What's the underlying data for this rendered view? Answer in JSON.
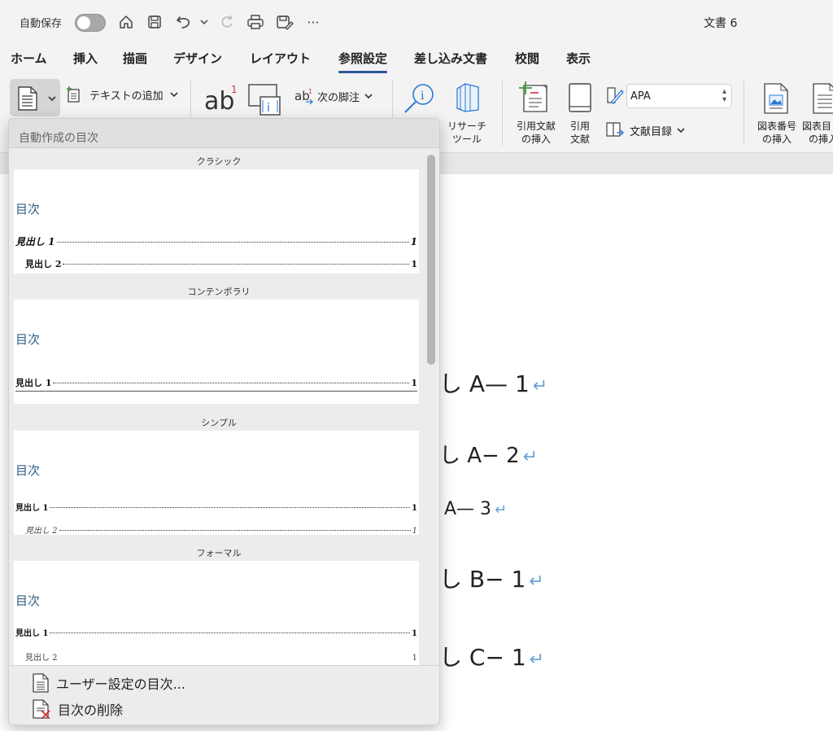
{
  "titlebar": {
    "autosave_label": "自動保存",
    "doc_title": "文書 6",
    "icons": [
      "toggle-off",
      "home-icon",
      "save-icon",
      "undo-icon",
      "chevron-down-icon",
      "redo-icon",
      "print-icon",
      "save-as-icon",
      "more-icon"
    ],
    "more_glyph": "···"
  },
  "tabs": [
    "ホーム",
    "挿入",
    "描画",
    "デザイン",
    "レイアウト",
    "参照設定",
    "差し込み文書",
    "校閲",
    "表示"
  ],
  "active_tab": "参照設定",
  "ribbon": {
    "add_text_label": "テキストの追加",
    "next_footnote_label": "次の脚注",
    "research_tool_label": [
      "リサーチ",
      "ツール"
    ],
    "insert_citation_label": [
      "引用文献",
      "の挿入"
    ],
    "citations_label": [
      "引用",
      "文献"
    ],
    "style_value": "APA",
    "bibliography_label": "文献目録",
    "insert_caption_label": [
      "図表番号",
      "の挿入"
    ],
    "table_of_figures_label": [
      "図表目",
      "の挿入"
    ]
  },
  "toc_dropdown": {
    "header": "自動作成の目次",
    "sections": [
      {
        "name": "クラシック",
        "toc_title": "目次",
        "rows": [
          {
            "text": "見出し 1",
            "page": "1"
          },
          {
            "text": "見出し 2",
            "page": "1"
          }
        ]
      },
      {
        "name": "コンテンポラリ",
        "toc_title": "目次",
        "rows": [
          {
            "text": "見出し 1",
            "page": "1"
          }
        ]
      },
      {
        "name": "シンプル",
        "toc_title": "目次",
        "rows": [
          {
            "text": "見出し 1",
            "page": "1"
          },
          {
            "text": "見出し 2",
            "page": "1"
          }
        ]
      },
      {
        "name": "フォーマル",
        "toc_title": "目次",
        "rows": [
          {
            "text": "見出し 1",
            "page": "1"
          },
          {
            "text": "見出し 2",
            "page": "1"
          }
        ]
      }
    ],
    "custom_toc": "ユーザー設定の目次...",
    "remove_toc": "目次の削除"
  },
  "document": {
    "headings": [
      "し A— 1",
      "し A− 2",
      "A— 3",
      "し B− 1",
      "し C− 1"
    ],
    "paragraph_mark": "↵"
  },
  "colors": {
    "accent": "#2b579a",
    "toc_title": "#2e5f87",
    "paragraph_mark": "#6aa3d8"
  }
}
